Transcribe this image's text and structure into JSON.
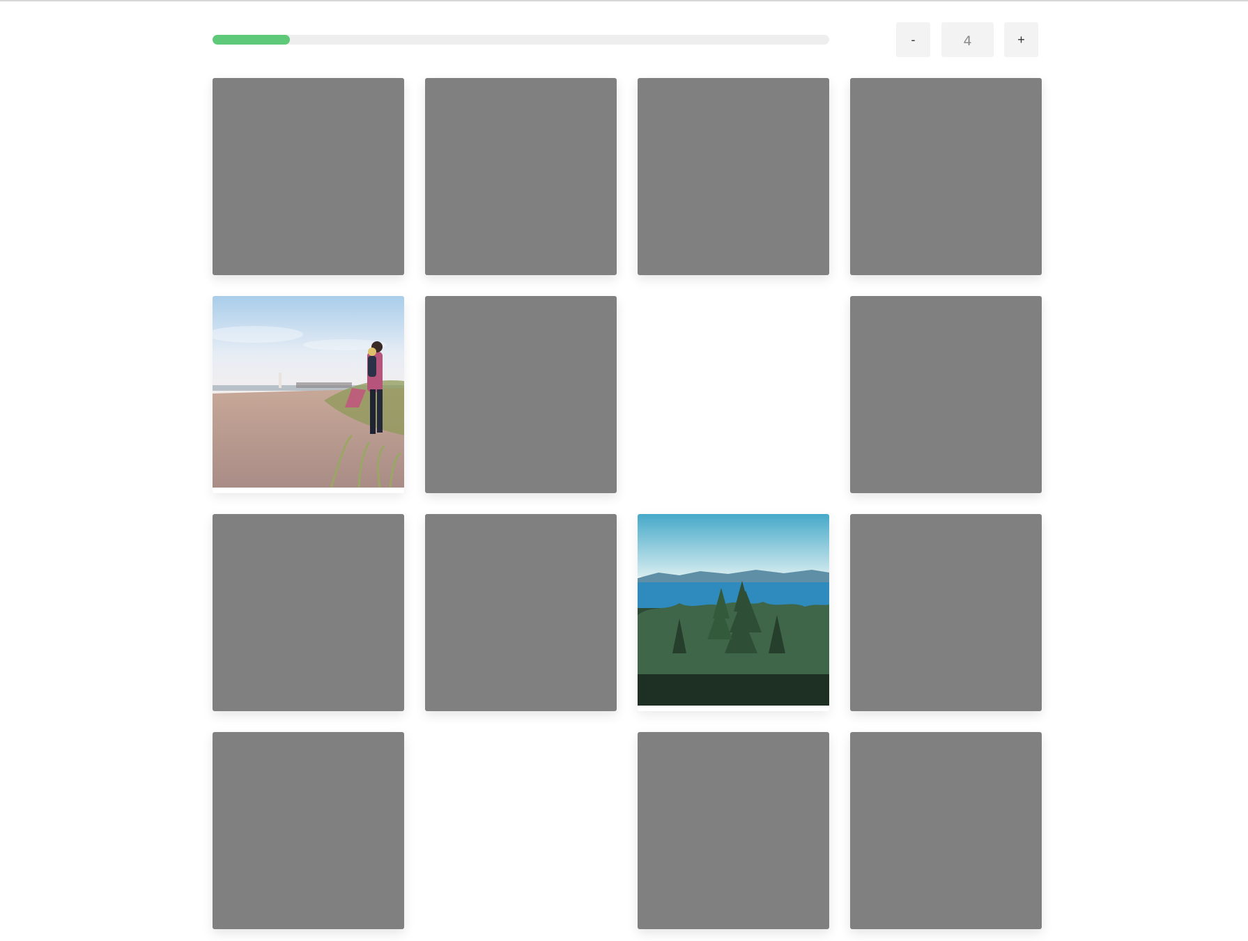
{
  "controls": {
    "decrement_label": "-",
    "increment_label": "+",
    "count_value": "4"
  },
  "progress": {
    "fraction": 0.125,
    "color": "#5ec978"
  },
  "tiles": [
    {
      "state": "hidden"
    },
    {
      "state": "hidden"
    },
    {
      "state": "hidden"
    },
    {
      "state": "hidden"
    },
    {
      "state": "flipped",
      "image": "beach-father-child-photo"
    },
    {
      "state": "hidden"
    },
    {
      "state": "matched"
    },
    {
      "state": "hidden"
    },
    {
      "state": "hidden"
    },
    {
      "state": "hidden"
    },
    {
      "state": "flipped",
      "image": "forest-sea-photo"
    },
    {
      "state": "hidden"
    },
    {
      "state": "hidden"
    },
    {
      "state": "matched"
    },
    {
      "state": "hidden"
    },
    {
      "state": "hidden"
    }
  ],
  "colors": {
    "card_back": "#808080",
    "button_bg": "#f3f3f3",
    "track": "#eeeeee"
  }
}
